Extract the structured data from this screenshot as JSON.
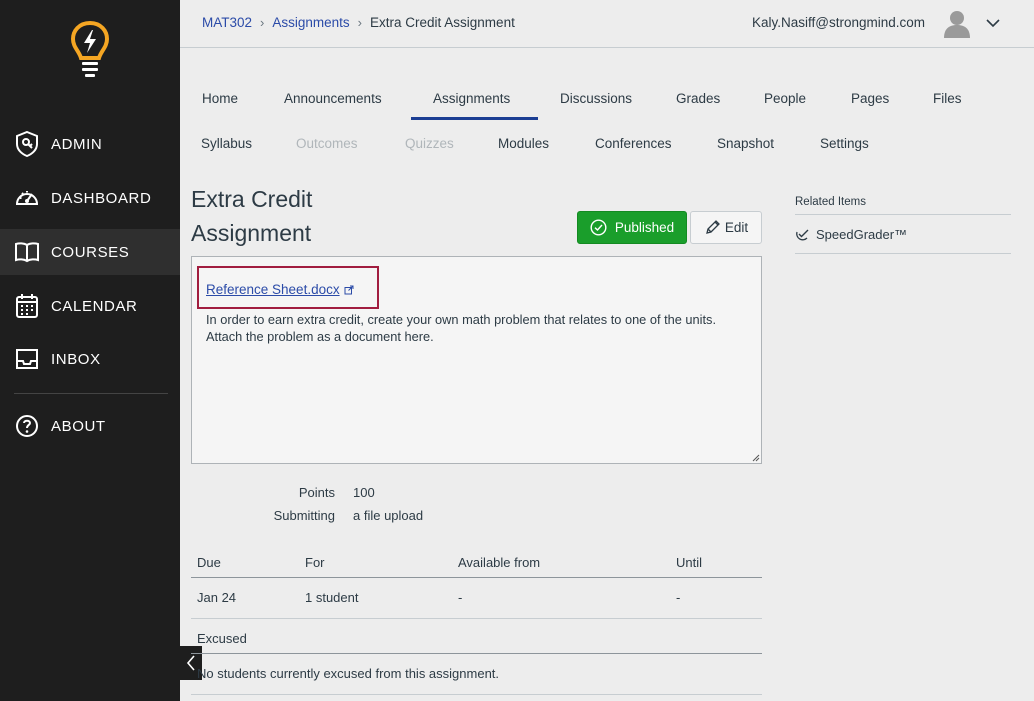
{
  "sidebar": {
    "logo": "lightbulb-logo",
    "items": [
      {
        "label": "ADMIN",
        "icon": "admin-shield-icon"
      },
      {
        "label": "DASHBOARD",
        "icon": "speedometer-icon"
      },
      {
        "label": "COURSES",
        "icon": "book-icon"
      },
      {
        "label": "CALENDAR",
        "icon": "calendar-icon"
      },
      {
        "label": "INBOX",
        "icon": "inbox-icon"
      },
      {
        "label": "ABOUT",
        "icon": "question-icon"
      }
    ],
    "active": "COURSES"
  },
  "header": {
    "breadcrumb": [
      "MAT302",
      "Assignments",
      "Extra Credit Assignment"
    ],
    "user_email": "Kaly.Nasiff@strongmind.com"
  },
  "course_nav": {
    "row1": [
      "Home",
      "Announcements",
      "Assignments",
      "Discussions",
      "Grades",
      "People",
      "Pages",
      "Files"
    ],
    "row2": [
      "Syllabus",
      "Outcomes",
      "Quizzes",
      "Modules",
      "Conferences",
      "Snapshot",
      "Settings"
    ],
    "active": "Assignments",
    "disabled": [
      "Outcomes",
      "Quizzes"
    ]
  },
  "assignment": {
    "title": "Extra Credit Assignment",
    "published_label": "Published",
    "edit_label": "Edit",
    "attachment_link": "Reference Sheet.docx",
    "description": "In order to earn extra credit, create your own math problem that relates to one of the units. Attach the problem as a document here.",
    "points_label": "Points",
    "points_value": "100",
    "submitting_label": "Submitting",
    "submitting_value": "a file upload"
  },
  "due_table": {
    "headers": [
      "Due",
      "For",
      "Available from",
      "Until"
    ],
    "rows": [
      [
        "Jan 24",
        "1 student",
        "-",
        "-"
      ]
    ]
  },
  "excused": {
    "label": "Excused",
    "message": "No students currently excused from this assignment."
  },
  "related": {
    "title": "Related Items",
    "speedgrader": "SpeedGrader™"
  },
  "colors": {
    "sidebar_bg": "#1e1e1e",
    "published_green": "#1a9e2b",
    "link_blue": "#2b4ba8",
    "highlight_red": "#a11d3f",
    "logo_yellow": "#f5a623"
  }
}
